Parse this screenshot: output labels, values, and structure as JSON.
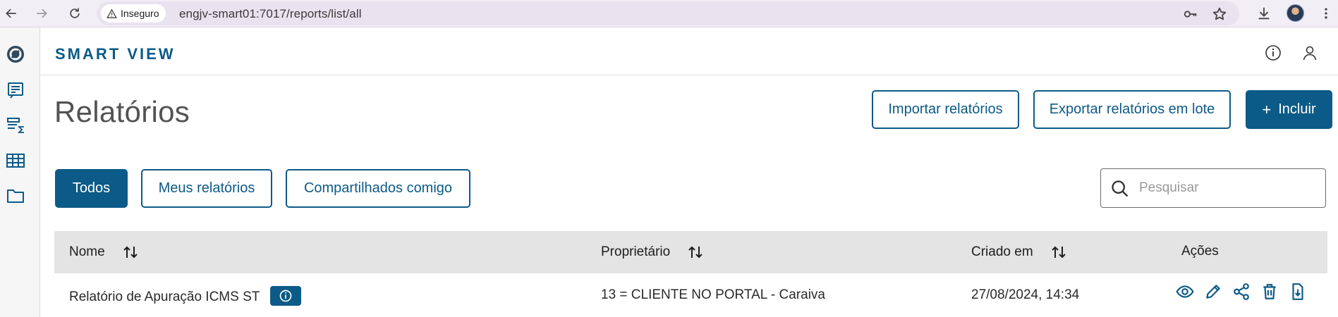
{
  "browser": {
    "security_label": "Inseguro",
    "url": "engjv-smart01:7017/reports/list/all"
  },
  "app": {
    "brand": "SMART VIEW"
  },
  "page": {
    "title": "Relatórios",
    "actions": {
      "import_label": "Importar relatórios",
      "export_label": "Exportar relatórios em lote",
      "add_label": "Incluir",
      "add_symbol": "+"
    },
    "filters": {
      "all_label": "Todos",
      "mine_label": "Meus relatórios",
      "shared_label": "Compartilhados comigo",
      "active": "all"
    },
    "search": {
      "placeholder": "Pesquisar"
    }
  },
  "table": {
    "columns": {
      "name": "Nome",
      "owner": "Proprietário",
      "created": "Criado em",
      "actions": "Ações"
    },
    "rows": [
      {
        "name": "Relatório de Apuração ICMS ST",
        "owner": "13 = CLIENTE NO PORTAL - Caraiva",
        "created": "27/08/2024, 14:34"
      }
    ]
  },
  "colors": {
    "primary": "#0c5a87",
    "header_bg": "#e4e4e4",
    "chrome_bg": "#f1eef5"
  }
}
